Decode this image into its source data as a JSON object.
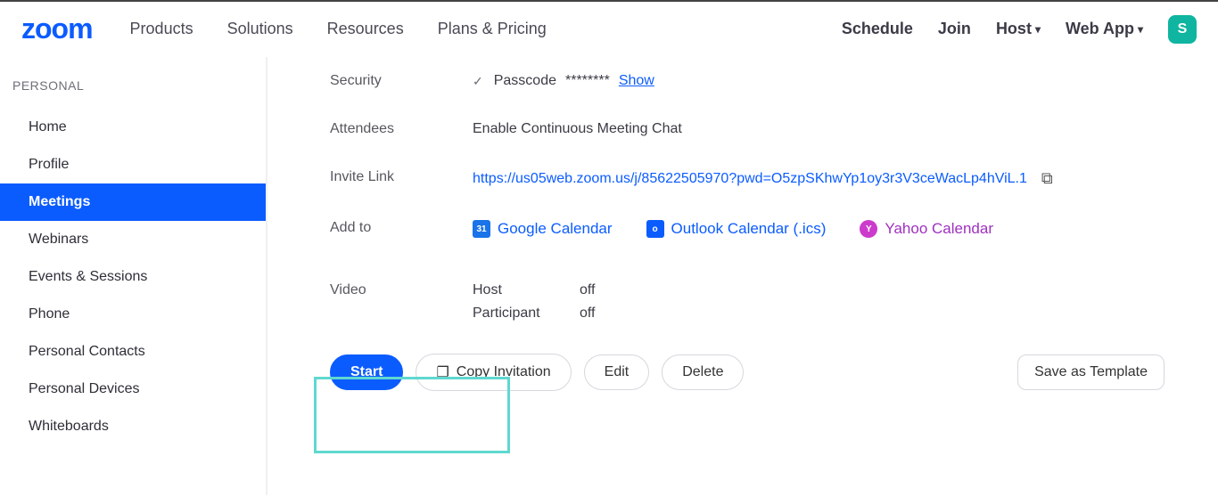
{
  "header": {
    "logo": "zoom",
    "nav_left": [
      "Products",
      "Solutions",
      "Resources",
      "Plans & Pricing"
    ],
    "nav_right": {
      "schedule": "Schedule",
      "join": "Join",
      "host": "Host",
      "webapp": "Web App"
    },
    "avatar_initial": "S"
  },
  "sidebar": {
    "section": "PERSONAL",
    "items": [
      "Home",
      "Profile",
      "Meetings",
      "Webinars",
      "Events & Sessions",
      "Phone",
      "Personal Contacts",
      "Personal Devices",
      "Whiteboards"
    ],
    "active_index": 2
  },
  "details": {
    "security": {
      "label": "Security",
      "passcode_label": "Passcode",
      "passcode_mask": "********",
      "show": "Show"
    },
    "attendees": {
      "label": "Attendees",
      "value": "Enable Continuous Meeting Chat"
    },
    "invite": {
      "label": "Invite Link",
      "url": "https://us05web.zoom.us/j/85622505970?pwd=O5zpSKhwYp1oy3r3V3ceWacLp4hViL.1"
    },
    "addto": {
      "label": "Add to",
      "google": "Google Calendar",
      "outlook": "Outlook Calendar (.ics)",
      "yahoo": "Yahoo Calendar"
    },
    "video": {
      "label": "Video",
      "host_label": "Host",
      "host_value": "off",
      "participant_label": "Participant",
      "participant_value": "off"
    }
  },
  "actions": {
    "start": "Start",
    "copy_invitation": "Copy Invitation",
    "edit": "Edit",
    "delete": "Delete",
    "save_template": "Save as Template"
  }
}
